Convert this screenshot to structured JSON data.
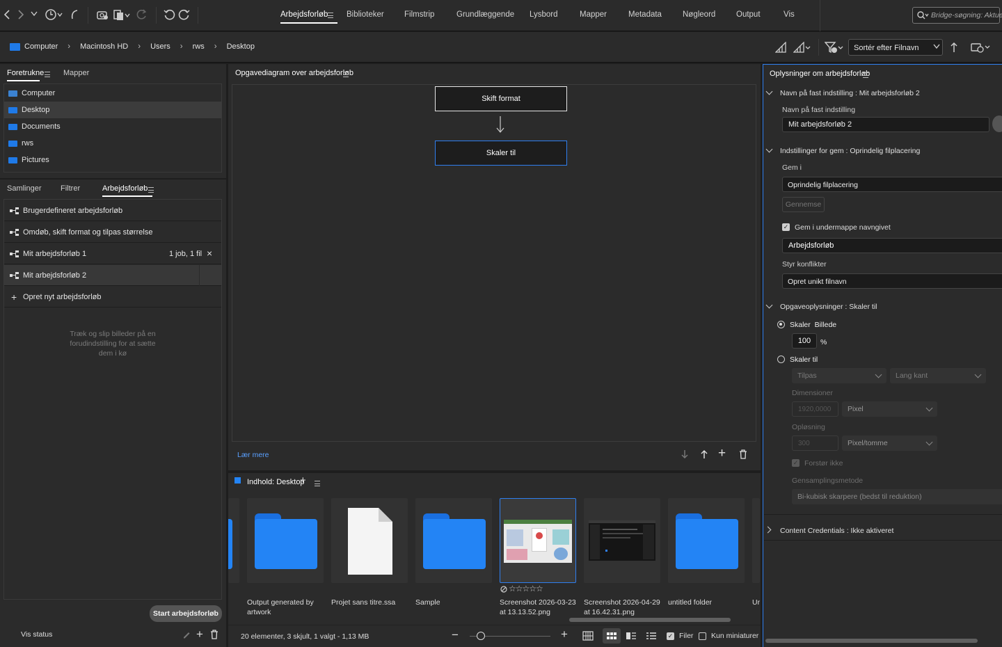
{
  "topbar": {
    "tabs": [
      "Arbejdsforløb",
      "Biblioteker",
      "Filmstrip",
      "Grundlæggende",
      "Lysbord",
      "Mapper",
      "Metadata",
      "Nøgleord",
      "Output",
      "Vis"
    ],
    "active_tab": "Arbejdsforløb",
    "search_placeholder": "Bridge-søgning: Aktuel"
  },
  "breadcrumb": [
    "Computer",
    "Macintosh HD",
    "Users",
    "rws",
    "Desktop"
  ],
  "sort": {
    "label": "Sortér efter Filnavn"
  },
  "favorites": {
    "tabs": [
      "Foretrukne",
      "Mapper"
    ],
    "items": [
      "Computer",
      "Desktop",
      "Documents",
      "rws",
      "Pictures"
    ],
    "selected": "Desktop"
  },
  "workflows": {
    "tabs": [
      "Samlinger",
      "Filtrer",
      "Arbejdsforløb"
    ],
    "items": [
      {
        "label": "Brugerdefineret arbejdsforløb",
        "status": ""
      },
      {
        "label": "Omdøb, skift format og tilpas størrelse",
        "status": ""
      },
      {
        "label": "Mit arbejdsforløb 1",
        "status": "1 job, 1 fil"
      },
      {
        "label": "Mit arbejdsforløb 2",
        "status": ""
      }
    ],
    "create": "Opret nyt arbejdsforløb",
    "hint": "Træk og slip billeder på en forudindstilling for at sætte dem i kø",
    "start_button": "Start arbejdsforløb",
    "show_status": "Vis status"
  },
  "diagram": {
    "title": "Opgavediagram over arbejdsforløb",
    "steps": [
      "Skift format",
      "Skaler til"
    ],
    "learn_more": "Lær mere"
  },
  "content": {
    "title": "Indhold: Desktop",
    "items": [
      {
        "name": "Output generated by artwork",
        "type": "folder"
      },
      {
        "name": "Projet sans titre.ssa",
        "type": "file"
      },
      {
        "name": "Sample",
        "type": "folder"
      },
      {
        "name": "Screenshot 2026-03-23 at 13.13.52.png",
        "type": "image",
        "selected": true,
        "rating": "☆☆☆☆☆"
      },
      {
        "name": "Screenshot 2026-04-29 at 16.42.31.png",
        "type": "image"
      },
      {
        "name": "untitled folder",
        "type": "folder"
      },
      {
        "name": "Ur",
        "type": "folder"
      }
    ],
    "status": "20 elementer, 3 skjult, 1 valgt - 1,13 MB",
    "files_label": "Filer",
    "thumbs_label": "Kun miniaturer"
  },
  "info": {
    "title": "Oplysninger om arbejdsforløb",
    "preset_section": "Navn på fast indstilling : Mit arbejdsforløb 2",
    "preset_label": "Navn på fast indstilling",
    "preset_value": "Mit arbejdsforløb 2",
    "save_section": "Indstillinger for gem : Oprindelig filplacering",
    "save_in_label": "Gem i",
    "save_in_value": "Oprindelig filplacering",
    "browse": "Gennemse",
    "subfolder_label": "Gem i undermappe navngivet",
    "subfolder_value": "Arbejdsforløb",
    "conflicts_label": "Styr konflikter",
    "conflicts_value": "Opret unikt filnavn",
    "task_section": "Opgaveoplysninger : Skaler til",
    "scale_image": "Skaler  Billede",
    "scale_value": "100",
    "percent": "%",
    "scale_to": "Skaler til",
    "fit": "Tilpas",
    "long_edge": "Lang kant",
    "dimensions_label": "Dimensioner",
    "dimensions_value": "1920,0000",
    "unit": "Pixel",
    "resolution_label": "Opløsning",
    "resolution_value": "300",
    "res_unit": "Pixel/tomme",
    "no_enlarge": "Forstør ikke",
    "resample_label": "Gensamplingsmetode",
    "resample_value": "Bi-kubisk skarpere (bedst til reduktion)",
    "credentials_section": "Content Credentials : Ikke aktiveret"
  }
}
